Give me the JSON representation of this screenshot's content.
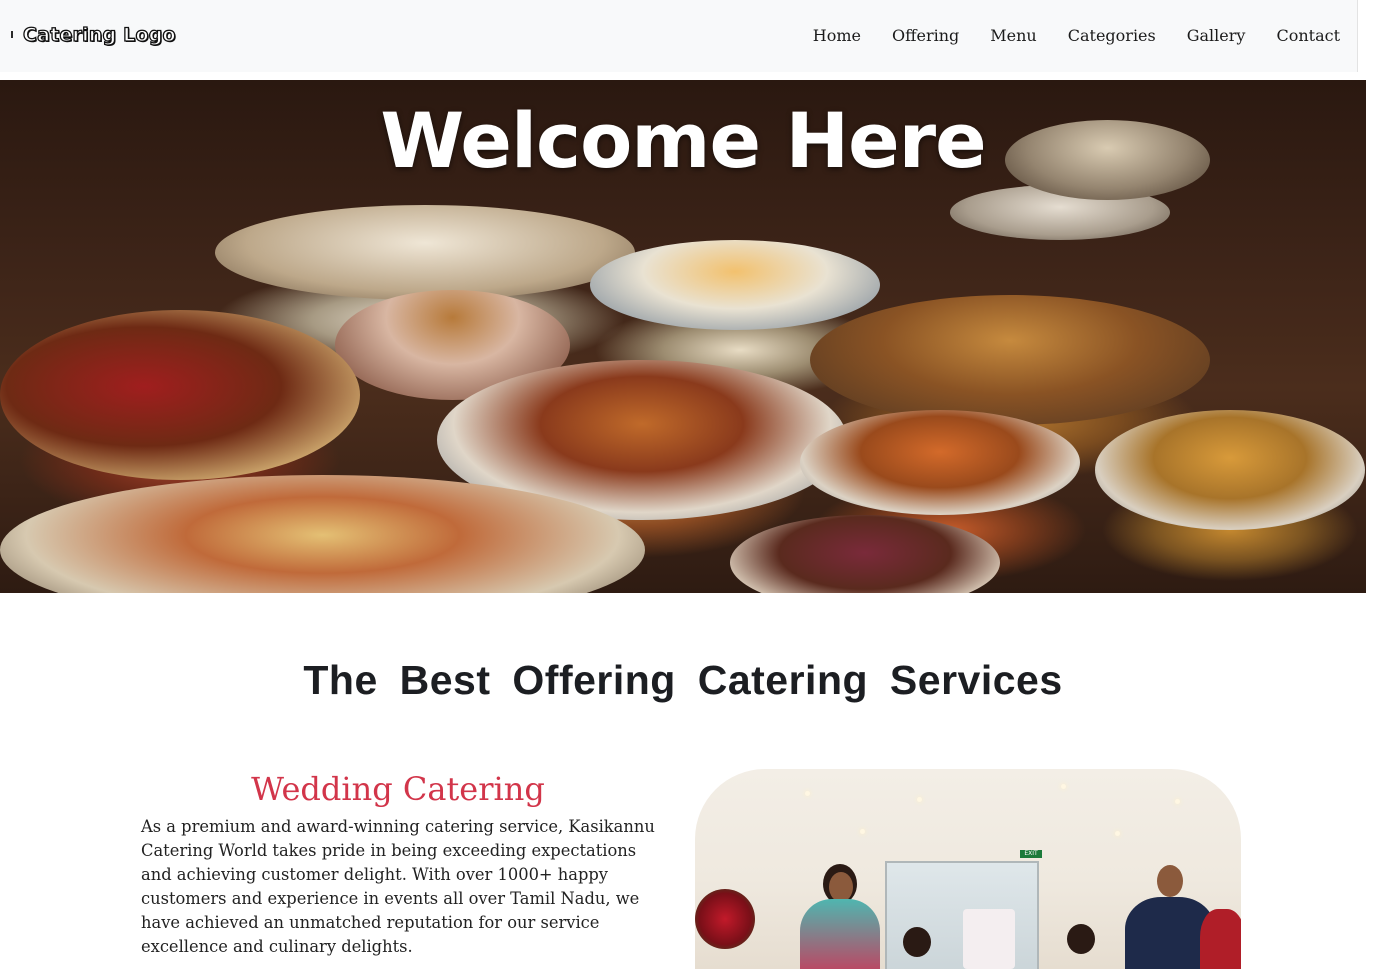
{
  "header": {
    "logo": "Catering Logo",
    "nav": [
      {
        "label": "Home"
      },
      {
        "label": "Offering"
      },
      {
        "label": "Menu"
      },
      {
        "label": "Categories"
      },
      {
        "label": "Gallery"
      },
      {
        "label": "Contact"
      }
    ]
  },
  "hero": {
    "title": "Welcome Here"
  },
  "offering": {
    "title": "The Best Offering Catering Services",
    "card": {
      "title": "Wedding Catering",
      "text": "As a premium and award-winning catering service, Kasikannu Catering World takes pride in being exceeding expectations and achieving customer delight. With over 1000+ happy customers and experience in events all over Tamil Nadu, we have achieved an unmatched reputation for our service excellence and culinary delights.",
      "image_sign": "EXIT"
    }
  },
  "colors": {
    "accent": "#d2354a",
    "nav_bg": "#f8f9fa",
    "heading": "#1c1e22"
  }
}
